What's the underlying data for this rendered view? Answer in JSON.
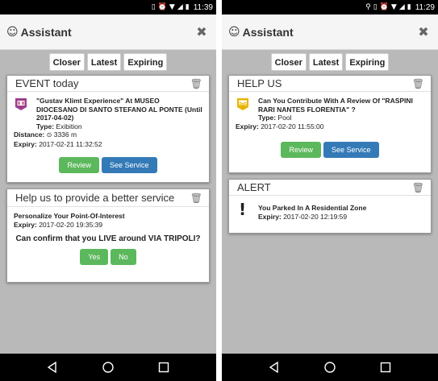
{
  "screens": [
    {
      "status": {
        "time": "11:39"
      },
      "header": {
        "title": "Assistant"
      },
      "filters": [
        "Closer",
        "Latest",
        "Expiring"
      ],
      "event_card": {
        "heading": "EVENT today",
        "title": "\"Gustav Klimt Experience\" At MUSEO DIOCESANO DI SANTO STEFANO AL PONTE (Until 2017-04-02)",
        "type_label": "Type:",
        "type_value": "Exibition",
        "distance_label": "Distance:",
        "distance_value": "3336 m",
        "expiry_label": "Expiry:",
        "expiry_value": "2017-02-21 11:32:52",
        "review_label": "Review",
        "service_label": "See Service"
      },
      "help_card": {
        "heading": "Help us to provide a better service",
        "poi_title": "Personalize Your Point-Of-Interest",
        "expiry_label": "Expiry:",
        "expiry_value": "2017-02-20 19:35:39",
        "question": "Can confirm that you LIVE around VIA TRIPOLI?",
        "yes_label": "Yes",
        "no_label": "No"
      }
    },
    {
      "status": {
        "time": "11:29"
      },
      "header": {
        "title": "Assistant"
      },
      "filters": [
        "Closer",
        "Latest",
        "Expiring"
      ],
      "helpus_card": {
        "heading": "HELP US",
        "title": "Can You Contribute With A Review Of \"RASPINI RARI NANTES FLORENTIA\" ?",
        "type_label": "Type:",
        "type_value": "Pool",
        "expiry_label": "Expiry:",
        "expiry_value": "2017-02-20 11:55:00",
        "review_label": "Review",
        "service_label": "See Service"
      },
      "alert_card": {
        "heading": "ALERT",
        "title": "You Parked In A Residential Zone",
        "expiry_label": "Expiry:",
        "expiry_value": "2017-02-20 12:19:59"
      }
    }
  ]
}
